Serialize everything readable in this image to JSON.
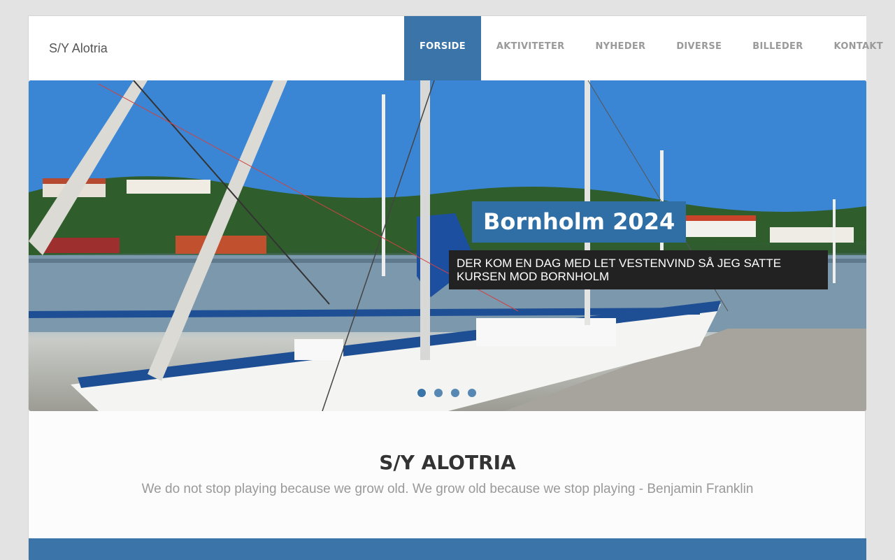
{
  "header": {
    "site_title": "S/Y Alotria",
    "nav": [
      {
        "label": "FORSIDE",
        "active": true
      },
      {
        "label": "AKTIVITETER",
        "active": false
      },
      {
        "label": "NYHEDER",
        "active": false
      },
      {
        "label": "DIVERSE",
        "active": false
      },
      {
        "label": "BILLEDER",
        "active": false
      },
      {
        "label": "KONTAKT",
        "active": false
      }
    ]
  },
  "slider": {
    "title": "Bornholm 2024",
    "subtitle": "DER KOM EN DAG MED LET VESTENVIND SÅ JEG SATTE KURSEN MOD BORNHOLM",
    "slide_count": 4,
    "active_slide": 0,
    "image": "sailboat-in-harbor-photo"
  },
  "intro": {
    "title": "S/Y ALOTRIA",
    "quote": "We do not stop playing because we grow old. We grow old because we stop playing - Benjamin Franklin"
  },
  "colors": {
    "accent": "#3a74a8",
    "caption_bg": "#222222"
  }
}
